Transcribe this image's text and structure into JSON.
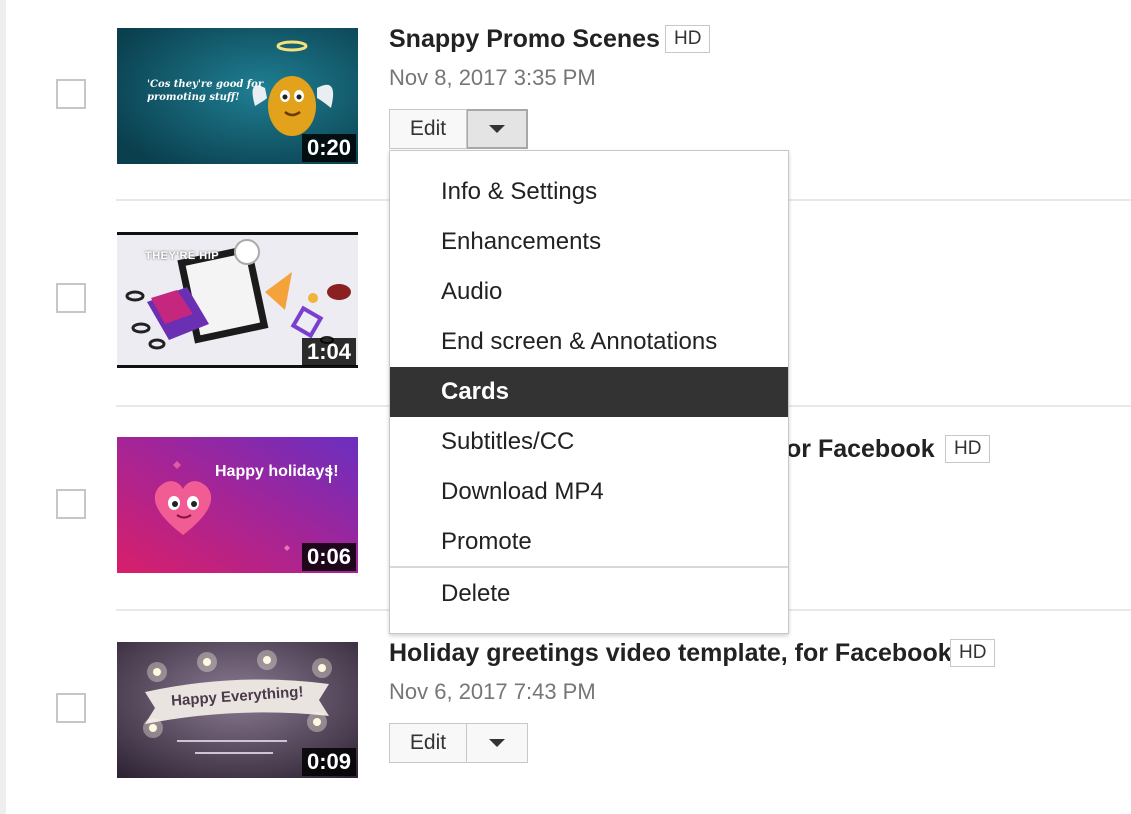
{
  "videos": [
    {
      "title": "Snappy Promo Scenes",
      "hd": "HD",
      "date": "Nov 8, 2017 3:35 PM",
      "duration": "0:20",
      "thumb_text": "'Cos they're good for promoting stuff!",
      "edit_label": "Edit"
    },
    {
      "duration": "1:04",
      "thumb_text": "THEY'RE HIP"
    },
    {
      "title_partial": "or Facebook",
      "hd": "HD",
      "duration": "0:06",
      "thumb_text": "Happy holidays!"
    },
    {
      "title": "Holiday greetings video template, for Facebook",
      "hd": "HD",
      "date": "Nov 6, 2017 7:43 PM",
      "duration": "0:09",
      "thumb_text": "Happy Everything!",
      "edit_label": "Edit"
    }
  ],
  "menu": {
    "items": [
      "Info & Settings",
      "Enhancements",
      "Audio",
      "End screen & Annotations",
      "Cards",
      "Subtitles/CC",
      "Download MP4",
      "Promote"
    ],
    "active_item": "Cards",
    "delete_label": "Delete"
  },
  "colors": {
    "menu_highlight": "#333333",
    "thumb1_bg": "#0d5a6b",
    "thumb3_bg": "#a12a8a"
  }
}
